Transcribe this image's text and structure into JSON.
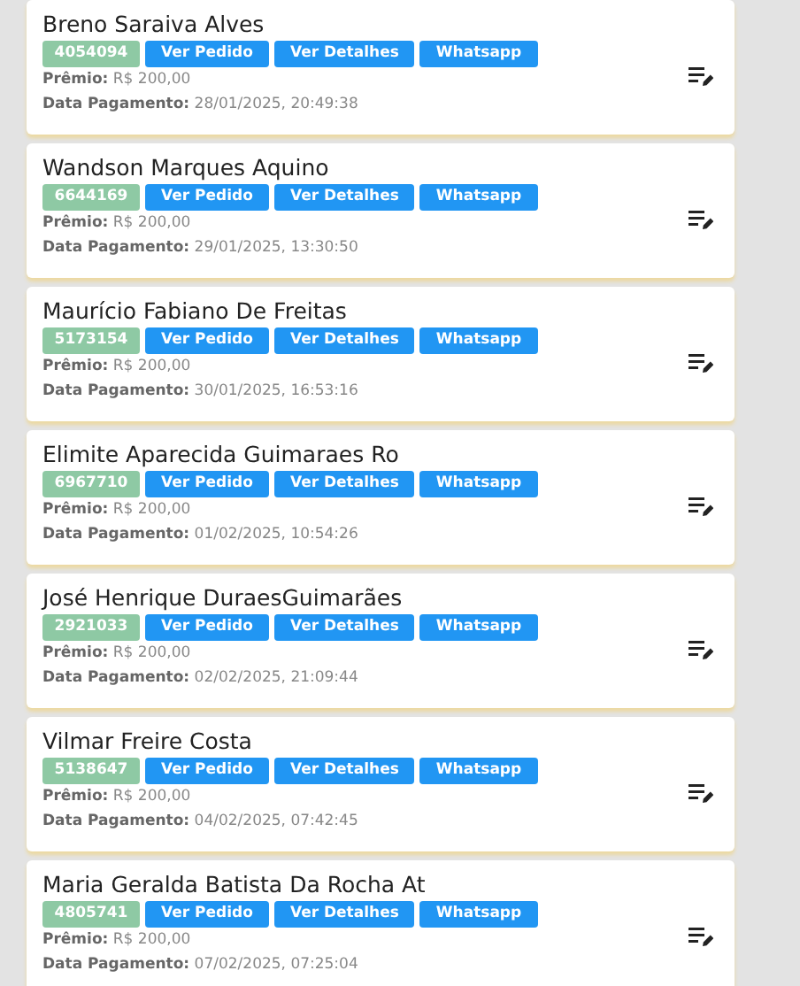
{
  "orders": [
    {
      "name": "Breno Saraiva Alves",
      "code": "4054094",
      "buttons": [
        "Ver Pedido",
        "Ver Detalhes",
        "Whatsapp"
      ],
      "prize": "**Prêmio:** R$ 200,00",
      "payment": "**Data Pagamento:** 28/01/2025, 20:49:38"
    },
    {
      "name": "Wandson Marques Aquino",
      "code": "6644169",
      "buttons": [
        "Ver Pedido",
        "Ver Detalhes",
        "Whatsapp"
      ],
      "prize": "**Prêmio:** R$ 200,00",
      "payment": "**Data Pagamento:** 29/01/2025, 13:30:50"
    },
    {
      "name": "Maurício Fabiano De Freitas",
      "code": "5173154",
      "buttons": [
        "Ver Pedido",
        "Ver Detalhes",
        "Whatsapp"
      ],
      "prize": "**Prêmio:** R$ 200,00",
      "payment": "**Data Pagamento:** 30/01/2025, 16:53:16"
    },
    {
      "name": "Elimite Aparecida Guimaraes Ro",
      "code": "6967710",
      "buttons": [
        "Ver Pedido",
        "Ver Detalhes",
        "Whatsapp"
      ],
      "prize": "**Prêmio:** R$ 200,00",
      "payment": "**Data Pagamento:** 01/02/2025, 10:54:26"
    },
    {
      "name": "José Henrique DuraesGuimarães",
      "code": "2921033",
      "buttons": [
        "Ver Pedido",
        "Ver Detalhes",
        "Whatsapp"
      ],
      "prize": "**Prêmio:** R$ 200,00",
      "payment": "**Data Pagamento:** 02/02/2025, 21:09:44"
    },
    {
      "name": "Vilmar Freire Costa",
      "code": "5138647",
      "buttons": [
        "Ver Pedido",
        "Ver Detalhes",
        "Whatsapp"
      ],
      "prize": "**Prêmio:** R$ 200,00",
      "payment": "**Data Pagamento:** 04/02/2025, 07:42:45"
    },
    {
      "name": "Maria Geralda Batista Da Rocha At",
      "code": "4805741",
      "buttons": [
        "Ver Pedido",
        "Ver Detalhes",
        "Whatsapp"
      ],
      "prize": "**Prêmio:** R$ 200,00",
      "payment": "**Data Pagamento:** 07/02/2025, 07:25:04"
    }
  ]
}
